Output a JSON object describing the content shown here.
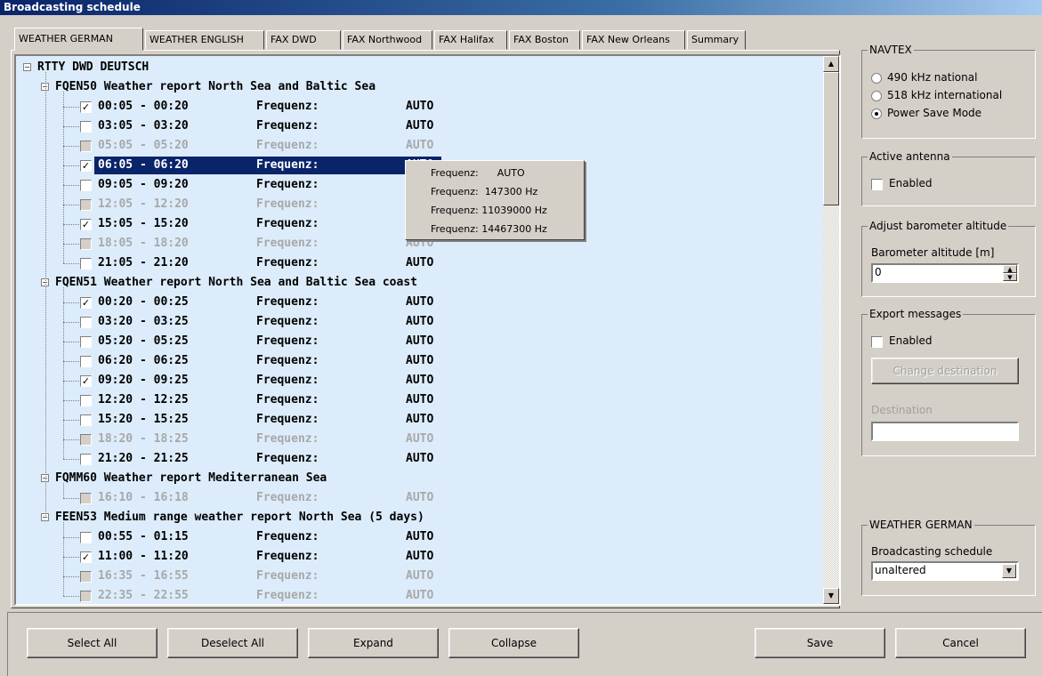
{
  "window": {
    "title": "Broadcasting schedule"
  },
  "tabs": [
    {
      "label": "WEATHER GERMAN",
      "active": true
    },
    {
      "label": "WEATHER ENGLISH"
    },
    {
      "label": "FAX DWD"
    },
    {
      "label": "FAX Northwood"
    },
    {
      "label": "FAX Halifax"
    },
    {
      "label": "FAX Boston"
    },
    {
      "label": "FAX New Orleans"
    },
    {
      "label": "Summary"
    }
  ],
  "tree": {
    "root": "RTTY DWD DEUTSCH",
    "freq_label": "Frequenz:",
    "groups": [
      {
        "label": "FQEN50 Weather report North Sea and Baltic Sea",
        "items": [
          {
            "time": "00:05 - 00:20",
            "value": "AUTO",
            "checked": true,
            "enabled": true
          },
          {
            "time": "03:05 - 03:20",
            "value": "AUTO",
            "checked": false,
            "enabled": true
          },
          {
            "time": "05:05 - 05:20",
            "value": "AUTO",
            "checked": false,
            "enabled": false
          },
          {
            "time": "06:05 - 06:20",
            "value": "AUTO",
            "checked": true,
            "enabled": true,
            "selected": true
          },
          {
            "time": "09:05 - 09:20",
            "value": "AUTO",
            "checked": false,
            "enabled": true
          },
          {
            "time": "12:05 - 12:20",
            "value": "AUTO",
            "checked": false,
            "enabled": false
          },
          {
            "time": "15:05 - 15:20",
            "value": "AUTO",
            "checked": true,
            "enabled": true
          },
          {
            "time": "18:05 - 18:20",
            "value": "AUTO",
            "checked": false,
            "enabled": false
          },
          {
            "time": "21:05 - 21:20",
            "value": "AUTO",
            "checked": false,
            "enabled": true
          }
        ]
      },
      {
        "label": "FQEN51 Weather report North Sea and Baltic Sea coast",
        "items": [
          {
            "time": "00:20 - 00:25",
            "value": "AUTO",
            "checked": true,
            "enabled": true
          },
          {
            "time": "03:20 - 03:25",
            "value": "AUTO",
            "checked": false,
            "enabled": true
          },
          {
            "time": "05:20 - 05:25",
            "value": "AUTO",
            "checked": false,
            "enabled": true
          },
          {
            "time": "06:20 - 06:25",
            "value": "AUTO",
            "checked": false,
            "enabled": true
          },
          {
            "time": "09:20 - 09:25",
            "value": "AUTO",
            "checked": true,
            "enabled": true
          },
          {
            "time": "12:20 - 12:25",
            "value": "AUTO",
            "checked": false,
            "enabled": true
          },
          {
            "time": "15:20 - 15:25",
            "value": "AUTO",
            "checked": false,
            "enabled": true
          },
          {
            "time": "18:20 - 18:25",
            "value": "AUTO",
            "checked": false,
            "enabled": false
          },
          {
            "time": "21:20 - 21:25",
            "value": "AUTO",
            "checked": false,
            "enabled": true
          }
        ]
      },
      {
        "label": "FQMM60 Weather report Mediterranean Sea",
        "items": [
          {
            "time": "16:10 - 16:18",
            "value": "AUTO",
            "checked": false,
            "enabled": false
          }
        ]
      },
      {
        "label": "FEEN53 Medium range weather report North Sea (5 days)",
        "items": [
          {
            "time": "00:55 - 01:15",
            "value": "AUTO",
            "checked": false,
            "enabled": true
          },
          {
            "time": "11:00 - 11:20",
            "value": "AUTO",
            "checked": true,
            "enabled": true
          },
          {
            "time": "16:35 - 16:55",
            "value": "AUTO",
            "checked": false,
            "enabled": false
          },
          {
            "time": "22:35 - 22:55",
            "value": "AUTO",
            "checked": false,
            "enabled": false
          }
        ]
      }
    ]
  },
  "tooltip": {
    "lines": [
      {
        "label": "Frequenz:",
        "value": "AUTO"
      },
      {
        "label": "Frequenz:",
        "value": "147300 Hz"
      },
      {
        "label": "Frequenz:",
        "value": "11039000 Hz"
      },
      {
        "label": "Frequenz:",
        "value": "14467300 Hz"
      }
    ]
  },
  "navtex": {
    "title": "NAVTEX",
    "options": [
      {
        "label": "490 kHz national",
        "selected": false
      },
      {
        "label": "518 kHz international",
        "selected": false
      },
      {
        "label": "Power Save Mode",
        "selected": true
      }
    ]
  },
  "antenna": {
    "title": "Active antenna",
    "enabled_label": "Enabled",
    "enabled": false
  },
  "barometer": {
    "title": "Adjust barometer altitude",
    "field_label": "Barometer altitude [m]",
    "value": "0"
  },
  "export": {
    "title": "Export messages",
    "enabled_label": "Enabled",
    "change_button": "Change destination",
    "destination_label": "Destination",
    "destination_value": ""
  },
  "schedule_group": {
    "title": "WEATHER GERMAN",
    "label": "Broadcasting schedule",
    "value": "unaltered"
  },
  "buttons": {
    "select_all": "Select All",
    "deselect_all": "Deselect All",
    "expand": "Expand",
    "collapse": "Collapse",
    "save": "Save",
    "cancel": "Cancel"
  },
  "colors": {
    "tree_bg": "#dcecfb",
    "selection": "#0a246a",
    "face": "#d4d0c8"
  }
}
